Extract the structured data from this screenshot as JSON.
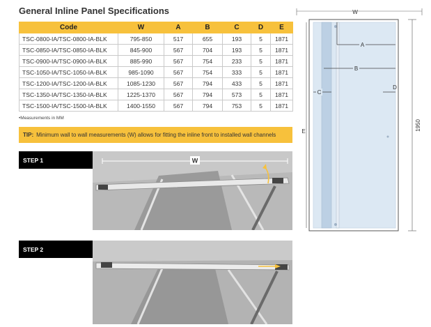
{
  "title": "General Inline Panel Specifications",
  "table": {
    "headers": [
      "Code",
      "W",
      "A",
      "B",
      "C",
      "D",
      "E"
    ],
    "rows": [
      [
        "TSC-0800-IA/TSC-0800-IA-BLK",
        "795-850",
        "517",
        "655",
        "193",
        "5",
        "1871"
      ],
      [
        "TSC-0850-IA/TSC-0850-IA-BLK",
        "845-900",
        "567",
        "704",
        "193",
        "5",
        "1871"
      ],
      [
        "TSC-0900-IA/TSC-0900-IA-BLK",
        "885-990",
        "567",
        "754",
        "233",
        "5",
        "1871"
      ],
      [
        "TSC-1050-IA/TSC-1050-IA-BLK",
        "985-1090",
        "567",
        "754",
        "333",
        "5",
        "1871"
      ],
      [
        "TSC-1200-IA/TSC-1200-IA-BLK",
        "1085-1230",
        "567",
        "794",
        "433",
        "5",
        "1871"
      ],
      [
        "TSC-1350-IA/TSC-1350-IA-BLK",
        "1225-1370",
        "567",
        "794",
        "573",
        "5",
        "1871"
      ],
      [
        "TSC-1500-IA/TSC-1500-IA-BLK",
        "1400-1550",
        "567",
        "794",
        "753",
        "5",
        "1871"
      ]
    ]
  },
  "note": "•Measurements in MM",
  "tip": {
    "label": "TIP:",
    "text": "Minimum wall to wall measurements (W) allows for fitting the inline front to installed wall channels"
  },
  "steps": [
    {
      "label": "STEP 1",
      "measure_label": "W"
    },
    {
      "label": "STEP 2"
    }
  ],
  "diagram": {
    "labels": {
      "W": "W",
      "A": "A",
      "B": "B",
      "C": "C",
      "D": "D",
      "E": "E",
      "height": "1950"
    }
  },
  "colors": {
    "accent": "#f7c13c",
    "glass": "#dce8f3",
    "channel": "#bcd0e4"
  }
}
